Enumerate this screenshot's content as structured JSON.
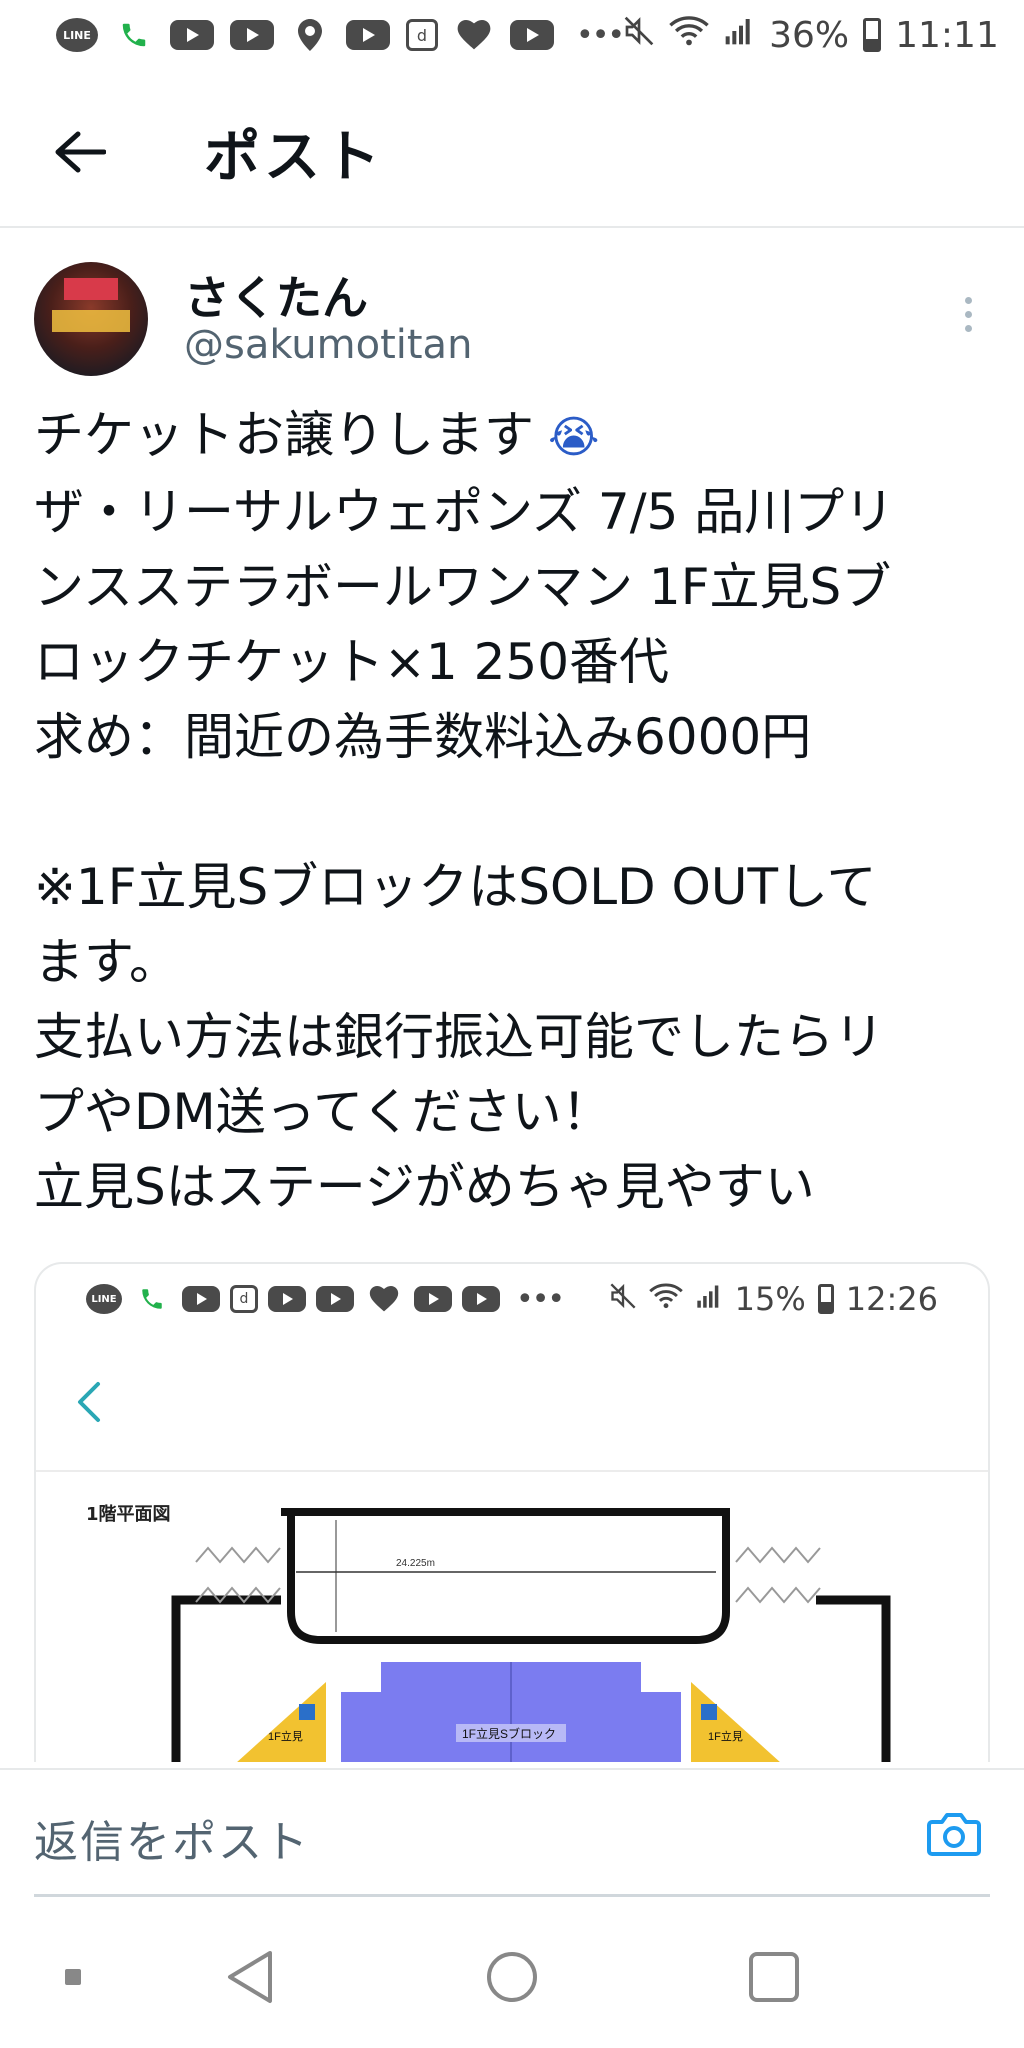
{
  "status_bar": {
    "battery": "36%",
    "time": "11:11",
    "line_label": "LINE",
    "d_label": "d",
    "more_dots": "•••"
  },
  "header": {
    "title": "ポスト"
  },
  "author": {
    "name": "さくたん",
    "handle": "@sakumotitan"
  },
  "tweet": {
    "lines": [
      "チケットお譲りします",
      "ザ・リーサルウェポンズ 7/5 品川プリ",
      "ンスステラボールワンマン 1F立見Sブ",
      "ロックチケット×1 250番代",
      "求め：間近の為手数料込み6000円",
      "",
      "※1F立見SブロックはSOLD OUTして",
      "ます。",
      "支払い方法は銀行振込可能でしたらリ",
      "プやDM送ってください！",
      "立見Sはステージがめちゃ見やすい"
    ]
  },
  "media": {
    "status_bar": {
      "battery": "15%",
      "time": "12:26",
      "line_label": "LINE",
      "d_label": "d",
      "more_dots": "•••"
    },
    "plan_label": "1階平面図",
    "block_label": "1F立見Sブロック",
    "side_label_left": "1F立見",
    "side_label_right": "1F立見",
    "dimension_label": "24.225m"
  },
  "reply": {
    "placeholder": "返信をポスト"
  },
  "colors": {
    "accent": "#1d9bf0",
    "text_primary": "#0f1419",
    "text_secondary": "#536471",
    "block_purple": "#7b7cf0",
    "side_yellow": "#f2c230"
  }
}
